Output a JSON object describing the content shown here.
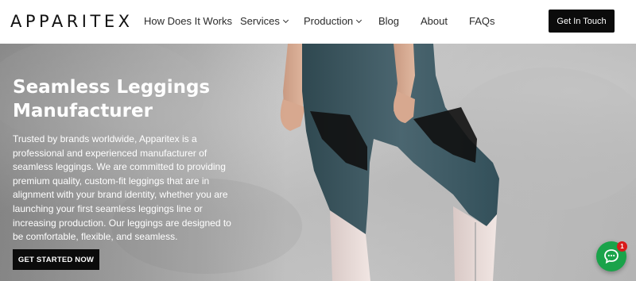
{
  "brand": {
    "logo_text": "APPARITEX"
  },
  "nav": {
    "items": [
      {
        "label": "How Does It Works",
        "has_dropdown": false
      },
      {
        "label": "Services",
        "has_dropdown": true
      },
      {
        "label": "Production",
        "has_dropdown": true
      },
      {
        "label": "Blog",
        "has_dropdown": false
      },
      {
        "label": "About",
        "has_dropdown": false
      },
      {
        "label": "FAQs",
        "has_dropdown": false
      }
    ],
    "cta_label": "Get In Touch"
  },
  "hero": {
    "title": "Seamless Leggings Manufacturer",
    "description": "Trusted by brands worldwide, Apparitex is a professional and experienced manufacturer of seamless leggings. We are committed to providing premium quality, custom-fit leggings that are in alignment with your brand identity, whether you are launching your first seamless leggings line or increasing production. Our leggings are designed to be comfortable, flexible, and seamless.",
    "cta_label": "GET STARTED NOW"
  },
  "chat_widget": {
    "icon": "chat-bubble-icon",
    "badge_count": "1"
  },
  "colors": {
    "accent": "#0b0b0b",
    "chat": "#1aa34a",
    "badge": "#d91b1b"
  }
}
